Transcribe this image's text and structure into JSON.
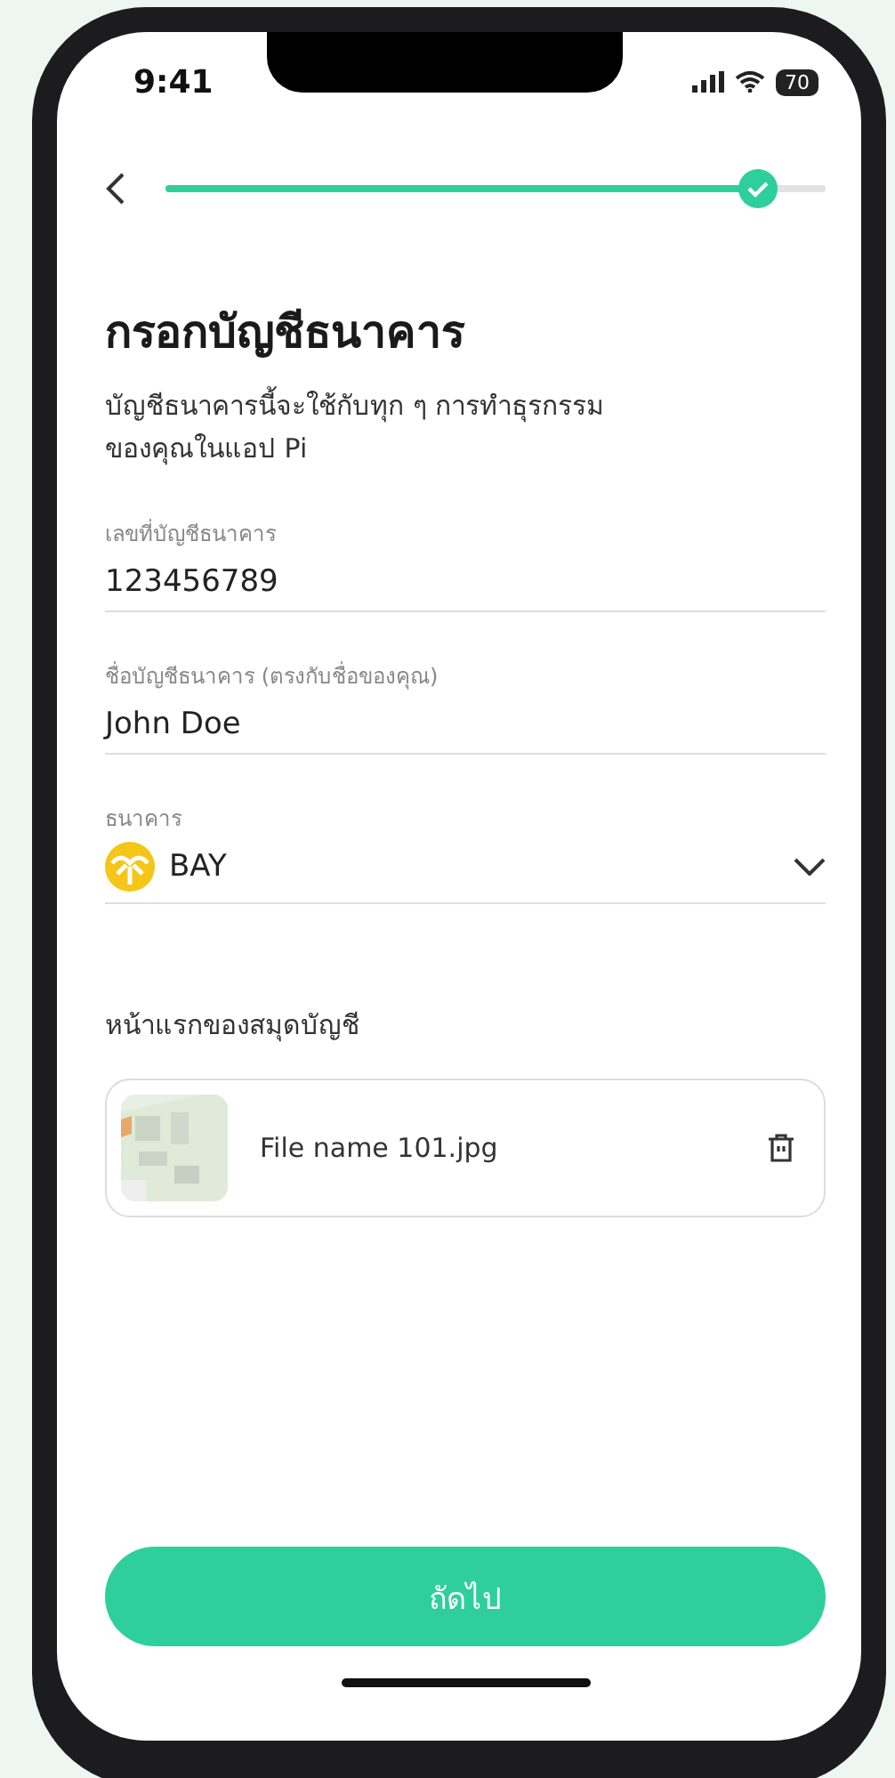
{
  "status_bar": {
    "time": "9:41",
    "battery": "70"
  },
  "progress": {
    "level": 0.9,
    "complete": true
  },
  "title": "กรอกบัญชีธนาคาร",
  "subtitle": "บัญชีธนาคารนี้จะใช้กับทุก ๆ การทำธุรกรรม ของคุณในแอป Pi",
  "fields": [
    {
      "kind": "text",
      "label": "เลขที่บัญชีธนาคาร",
      "value": "123456789"
    },
    {
      "kind": "text",
      "label": "ชื่อบัญชีธนาคาร (ตรงกับชื่อของคุณ)",
      "value": "John Doe"
    },
    {
      "kind": "select",
      "label": "ธนาคาร",
      "value": "BAY"
    }
  ],
  "upload": {
    "label": "หน้าแรกของสมุดบัญชี",
    "file_name": "File name 101.jpg"
  },
  "next_button": "ถัดไป"
}
